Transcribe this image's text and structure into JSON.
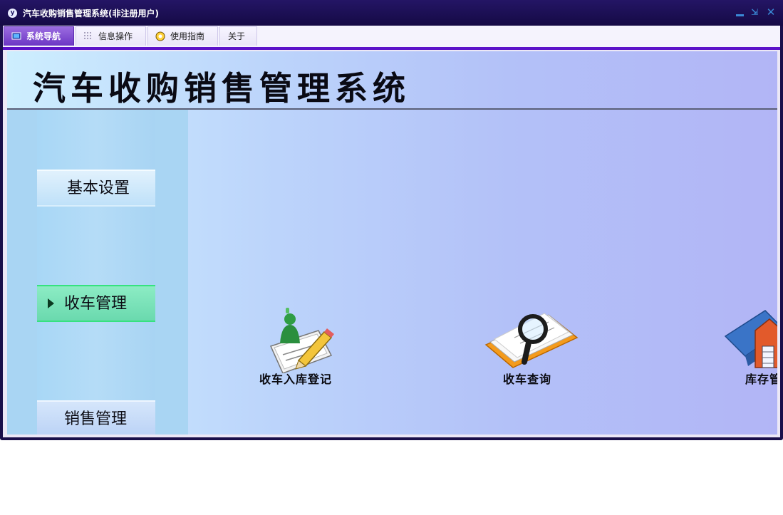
{
  "window": {
    "title": "汽车收购销售管理系统(非注册用户)",
    "app_icon": "y"
  },
  "menu": {
    "tabs": [
      {
        "label": "系统导航",
        "icon": "monitor-icon",
        "active": true
      },
      {
        "label": "信息操作",
        "icon": "grid-icon",
        "active": false
      },
      {
        "label": "使用指南",
        "icon": "guide-icon",
        "active": false
      },
      {
        "label": "关于",
        "active": false
      }
    ]
  },
  "header": {
    "title": "汽车收购销售管理系统"
  },
  "sidebar": {
    "items": [
      {
        "label": "基本设置",
        "selected": false
      },
      {
        "label": "收车管理",
        "selected": true
      },
      {
        "label": "销售管理",
        "selected": false
      }
    ]
  },
  "functions": [
    {
      "label": "收车入库登记",
      "icon": "register-pencil-icon"
    },
    {
      "label": "收车查询",
      "icon": "magnifier-icon"
    },
    {
      "label": "库存管理",
      "icon": "warehouse-icon"
    }
  ],
  "colors": {
    "title_bar": "#1a0f4a",
    "active_tab": "#7a44d0",
    "accent_line": "#5c12c9",
    "selected_item": "#7de3b9"
  }
}
